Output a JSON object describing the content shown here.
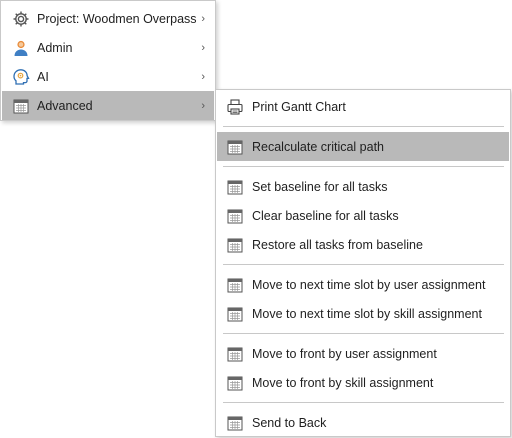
{
  "main_menu": {
    "items": [
      {
        "label": "Project: Woodmen Overpass",
        "icon": "gear-icon",
        "has_submenu": true
      },
      {
        "label": "Admin",
        "icon": "user-icon",
        "has_submenu": true
      },
      {
        "label": "AI",
        "icon": "ai-head-icon",
        "has_submenu": true
      },
      {
        "label": "Advanced",
        "icon": "calendar-icon",
        "has_submenu": true,
        "highlighted": true
      }
    ],
    "chevron": "›"
  },
  "advanced_submenu": {
    "items": [
      {
        "label": "Print Gantt Chart",
        "icon": "printer-icon"
      },
      {
        "label": "Recalculate critical path",
        "icon": "calendar-icon",
        "highlighted": true
      },
      {
        "label": "Set baseline for all tasks",
        "icon": "calendar-icon"
      },
      {
        "label": "Clear baseline for all tasks",
        "icon": "calendar-icon"
      },
      {
        "label": "Restore all tasks from baseline",
        "icon": "calendar-icon"
      },
      {
        "label": "Move to next time slot by user assignment",
        "icon": "calendar-icon"
      },
      {
        "label": "Move to next time slot by skill assignment",
        "icon": "calendar-icon"
      },
      {
        "label": "Move to front by user assignment",
        "icon": "calendar-icon"
      },
      {
        "label": "Move to front by skill assignment",
        "icon": "calendar-icon"
      },
      {
        "label": "Send to Back",
        "icon": "calendar-icon"
      }
    ]
  },
  "colors": {
    "highlight": "#b9b9b9",
    "separator": "#c8c8c8",
    "user_icon": "#e88b3a",
    "ai_icon": "#2f6fb3"
  }
}
